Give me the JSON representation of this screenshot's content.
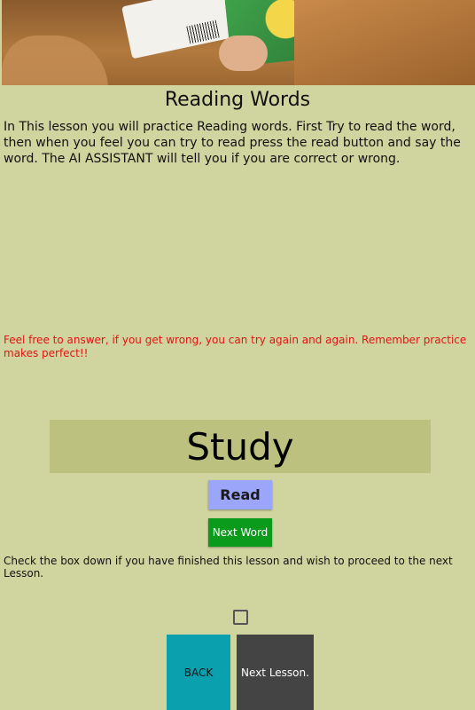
{
  "lesson": {
    "title": "Reading Words",
    "intro": "In This lesson you will practice Reading words.  First Try to read the word, then when you feel you can try to read press the read button and say the word. The AI ASSISTANT will tell you if you are correct or wrong.",
    "encouragement": "Feel free to answer, if you get wrong, you can try again and again. Remember practice makes perfect!!",
    "current_word": "Study"
  },
  "buttons": {
    "read_label": "Read",
    "next_word_label": "Next Word",
    "back_label": "BACK",
    "next_lesson_label": "Next Lesson."
  },
  "completion": {
    "note": "Check the box down if you have finished this lesson and wish to proceed to the next Lesson.",
    "checked": false
  },
  "colors": {
    "background": "#d0d49e",
    "word_panel": "#bdc180",
    "read_button": "#9ba5fa",
    "next_word_button": "#0a9a1c",
    "back_button": "#0aa0ad",
    "next_lesson_button": "#444444",
    "encouragement_text": "#e41414"
  }
}
